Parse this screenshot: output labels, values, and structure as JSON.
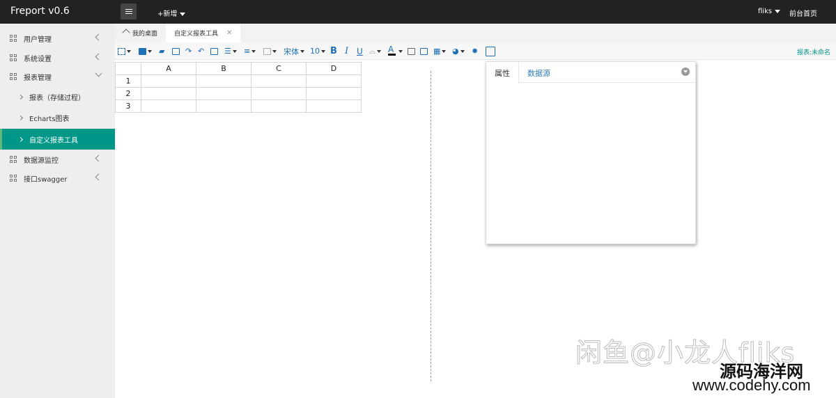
{
  "app": {
    "title": "Freport v0.6"
  },
  "header": {
    "add_new": "+新增",
    "user": "fliks",
    "front_page": "前台首页"
  },
  "sidebar": {
    "items": [
      {
        "label": "用户管理",
        "icon": "grid-icon",
        "expanded": false
      },
      {
        "label": "系统设置",
        "icon": "grid-icon",
        "expanded": false
      },
      {
        "label": "报表管理",
        "icon": "grid-icon",
        "expanded": true,
        "children": [
          {
            "label": "报表（存储过程）"
          },
          {
            "label": "Echarts图表"
          },
          {
            "label": "自定义报表工具",
            "active": true
          }
        ]
      },
      {
        "label": "数据源监控",
        "icon": "grid-icon",
        "expanded": false
      },
      {
        "label": "接口swagger",
        "icon": "grid-icon",
        "expanded": false
      }
    ]
  },
  "tabs": [
    {
      "label": "我的桌面",
      "icon": "home-icon"
    },
    {
      "label": "自定义报表工具",
      "active": true,
      "closable": true
    }
  ],
  "toolbar": {
    "font_name": "宋体",
    "font_size": "10",
    "bold": "B",
    "italic": "I",
    "underline": "U",
    "font_color_letter": "A",
    "report_name": "报表:未命名"
  },
  "sheet": {
    "columns": [
      "A",
      "B",
      "C",
      "D"
    ],
    "rows": [
      "1",
      "2",
      "3"
    ]
  },
  "panel": {
    "tabs": [
      "属性",
      "数据源"
    ]
  },
  "watermark": {
    "line1": "闲鱼@小龙人fliks",
    "line2": "源码海洋网",
    "line3": "www.codehy.com"
  },
  "colors": {
    "accent": "#009688",
    "topbar": "#222222",
    "toolbar_icon": "#1e6fb5"
  }
}
